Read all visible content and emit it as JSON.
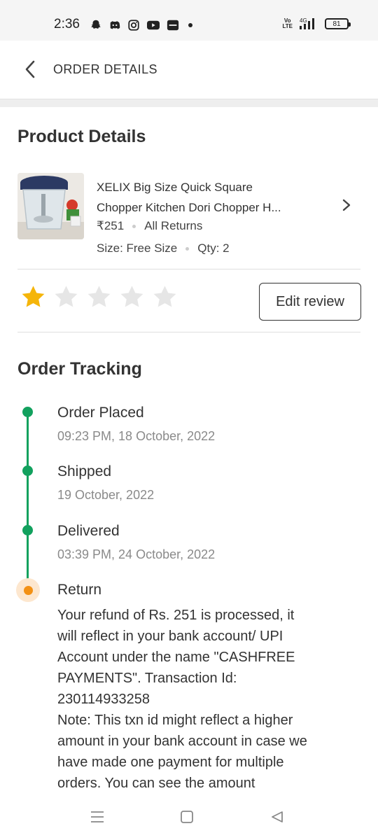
{
  "status_bar": {
    "time": "2:36",
    "icons": [
      "snapchat-icon",
      "discord-icon",
      "instagram-icon",
      "youtube-icon",
      "app-icon",
      "more-notifications-dot"
    ],
    "network": "4G",
    "volte": "Vo LTE",
    "battery": "81"
  },
  "header": {
    "title": "ORDER DETAILS"
  },
  "product_section": {
    "title": "Product Details",
    "product": {
      "name_line1": "XELIX Big Size Quick Square",
      "name_line2": "Chopper Kitchen Dori Chopper H...",
      "price": "₹251",
      "returns": "All Returns",
      "size": "Size: Free Size",
      "qty": "Qty: 2"
    },
    "rating": 1,
    "rating_max": 5,
    "edit_review_label": "Edit review"
  },
  "tracking": {
    "title": "Order Tracking",
    "steps": [
      {
        "title": "Order Placed",
        "subtitle": "09:23 PM, 18 October, 2022"
      },
      {
        "title": "Shipped",
        "subtitle": "19 October, 2022"
      },
      {
        "title": "Delivered",
        "subtitle": "03:39 PM, 24 October, 2022"
      },
      {
        "title": "Return",
        "body": "Your refund of Rs. 251 is processed, it\nwill reflect in your bank account/ UPI\nAccount under the name \"CASHFREE\nPAYMENTS\". Transaction Id:\n230114933258\nNote: This txn id might reflect a higher\namount in your bank account in case we\nhave made one payment for multiple\norders. You can see the amount"
      }
    ]
  },
  "colors": {
    "accent_green": "#12a15e",
    "return_orange": "#f39115",
    "star_gold": "#f5b50a",
    "star_empty": "#e6e6e6"
  },
  "nav_bar": {
    "icons": [
      "menu-icon",
      "home-square-icon",
      "back-triangle-icon"
    ]
  }
}
